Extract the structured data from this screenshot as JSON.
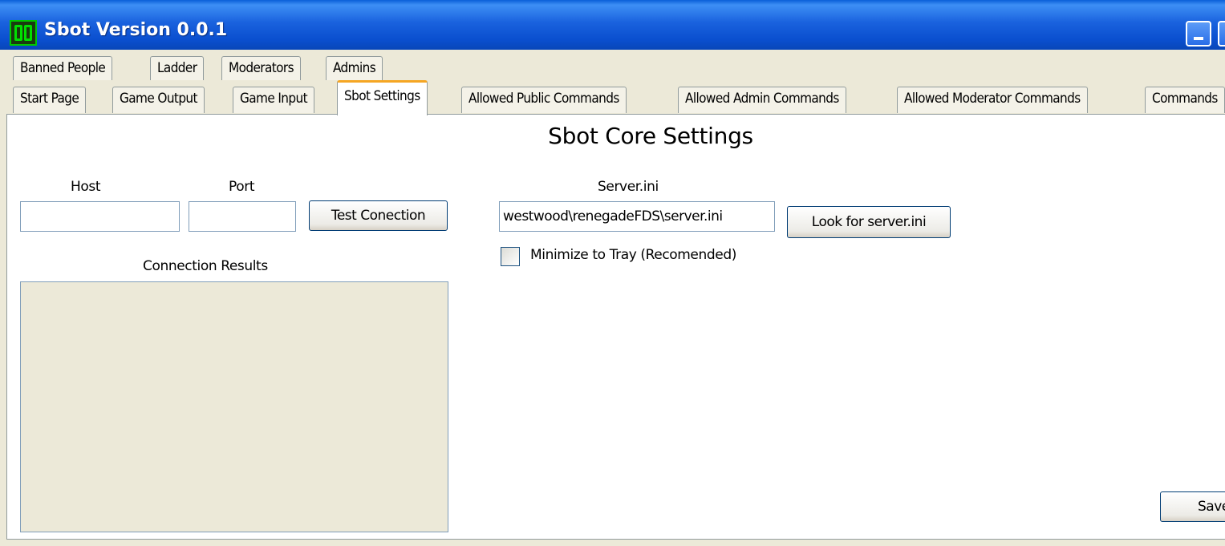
{
  "window": {
    "title": "Sbot Version 0.0.1"
  },
  "tabs_row1": [
    "Banned People",
    "Ladder",
    "Moderators",
    "Admins"
  ],
  "tabs_row2": [
    "Start Page",
    "Game Output",
    "Game Input",
    "Sbot Settings",
    "Allowed Public Commands",
    "Allowed Admin Commands",
    "Allowed Moderator Commands",
    "Commands"
  ],
  "active_tab": "Sbot Settings",
  "panel": {
    "heading": "Sbot Core Settings",
    "host_label": "Host",
    "host_value": "",
    "port_label": "Port",
    "port_value": "",
    "test_button": "Test Conection",
    "results_label": "Connection Results",
    "server_ini_label": "Server.ini",
    "server_ini_value": "westwood\\renegadeFDS\\server.ini",
    "look_button": "Look for server.ini",
    "minimize_tray_label": "Minimize to Tray (Recomended)",
    "minimize_tray_checked": false,
    "save_button": "Save"
  }
}
